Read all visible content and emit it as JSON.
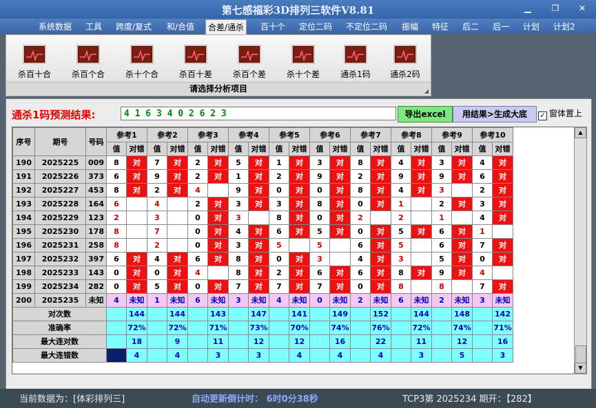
{
  "window": {
    "title": "第七感福彩3D排列三软件V8.81"
  },
  "menu": [
    "系统数据",
    "工具",
    "跨度/复式",
    "和/合值",
    "合差/通杀",
    "百十个",
    "定位二码",
    "不定位二码",
    "振幅",
    "特征",
    "后二",
    "后一",
    "计划",
    "计划2"
  ],
  "menu_active_index": 4,
  "ribbon": {
    "buttons": [
      "杀百十合",
      "杀百个合",
      "杀十个合",
      "杀百十差",
      "杀百个差",
      "杀十个差",
      "通杀1码",
      "通杀2码"
    ],
    "footer": "请选择分析项目"
  },
  "prediction": {
    "label": "通杀1码预测结果:",
    "digits": "4 1 6 3 4 0 2 6 2 3",
    "export_button": "导出excel",
    "big_button": "用结果>生成大底",
    "on_top_label": "窗体置上",
    "on_top_checked": true
  },
  "table": {
    "headers": {
      "seq": "序号",
      "issue": "期号",
      "number": "号码",
      "value": "值",
      "judge": "对错"
    },
    "refs": [
      "参考1",
      "参考2",
      "参考3",
      "参考4",
      "参考5",
      "参考6",
      "参考7",
      "参考8",
      "参考9",
      "参考10"
    ],
    "mark_right": "对",
    "rows": [
      {
        "seq": "190",
        "issue": "2025225",
        "num": "009",
        "cells": [
          [
            "8",
            "对",
            0
          ],
          [
            "7",
            "对",
            0
          ],
          [
            "2",
            "对",
            0
          ],
          [
            "5",
            "对",
            0
          ],
          [
            "1",
            "对",
            0
          ],
          [
            "3",
            "对",
            0
          ],
          [
            "8",
            "对",
            0
          ],
          [
            "4",
            "对",
            0
          ],
          [
            "3",
            "对",
            0
          ],
          [
            "4",
            "对",
            0
          ]
        ]
      },
      {
        "seq": "191",
        "issue": "2025226",
        "num": "373",
        "cells": [
          [
            "6",
            "对",
            0
          ],
          [
            "9",
            "对",
            0
          ],
          [
            "2",
            "对",
            0
          ],
          [
            "1",
            "对",
            0
          ],
          [
            "2",
            "对",
            0
          ],
          [
            "9",
            "对",
            0
          ],
          [
            "2",
            "对",
            0
          ],
          [
            "9",
            "对",
            0
          ],
          [
            "9",
            "对",
            0
          ],
          [
            "6",
            "对",
            0
          ]
        ]
      },
      {
        "seq": "192",
        "issue": "2025227",
        "num": "453",
        "cells": [
          [
            "8",
            "对",
            0
          ],
          [
            "2",
            "对",
            0
          ],
          [
            "4",
            "",
            1
          ],
          [
            "9",
            "对",
            0
          ],
          [
            "0",
            "对",
            0
          ],
          [
            "0",
            "对",
            0
          ],
          [
            "8",
            "对",
            0
          ],
          [
            "4",
            "对",
            0
          ],
          [
            "3",
            "",
            1
          ],
          [
            "2",
            "对",
            0
          ]
        ]
      },
      {
        "seq": "193",
        "issue": "2025228",
        "num": "164",
        "cells": [
          [
            "6",
            "",
            1
          ],
          [
            "4",
            "",
            1
          ],
          [
            "2",
            "对",
            0
          ],
          [
            "3",
            "对",
            0
          ],
          [
            "3",
            "对",
            0
          ],
          [
            "8",
            "对",
            0
          ],
          [
            "0",
            "对",
            0
          ],
          [
            "1",
            "",
            1
          ],
          [
            "2",
            "对",
            0
          ],
          [
            "3",
            "对",
            0
          ]
        ]
      },
      {
        "seq": "194",
        "issue": "2025229",
        "num": "123",
        "cells": [
          [
            "2",
            "",
            1
          ],
          [
            "3",
            "",
            1
          ],
          [
            "0",
            "对",
            0
          ],
          [
            "3",
            "",
            1
          ],
          [
            "8",
            "对",
            0
          ],
          [
            "0",
            "对",
            0
          ],
          [
            "2",
            "",
            1
          ],
          [
            "2",
            "",
            1
          ],
          [
            "1",
            "",
            1
          ],
          [
            "4",
            "对",
            0
          ]
        ]
      },
      {
        "seq": "195",
        "issue": "2025230",
        "num": "178",
        "cells": [
          [
            "8",
            "",
            1
          ],
          [
            "7",
            "",
            1
          ],
          [
            "0",
            "对",
            0
          ],
          [
            "4",
            "对",
            0
          ],
          [
            "6",
            "对",
            0
          ],
          [
            "5",
            "对",
            0
          ],
          [
            "0",
            "对",
            0
          ],
          [
            "5",
            "对",
            0
          ],
          [
            "6",
            "对",
            0
          ],
          [
            "1",
            "",
            1
          ]
        ]
      },
      {
        "seq": "196",
        "issue": "2025231",
        "num": "258",
        "cells": [
          [
            "8",
            "",
            1
          ],
          [
            "2",
            "",
            1
          ],
          [
            "0",
            "对",
            0
          ],
          [
            "3",
            "对",
            0
          ],
          [
            "5",
            "",
            1
          ],
          [
            "5",
            "",
            1
          ],
          [
            "6",
            "对",
            0
          ],
          [
            "5",
            "",
            1
          ],
          [
            "6",
            "对",
            0
          ],
          [
            "7",
            "对",
            0
          ]
        ]
      },
      {
        "seq": "197",
        "issue": "2025232",
        "num": "397",
        "cells": [
          [
            "6",
            "对",
            0
          ],
          [
            "4",
            "对",
            0
          ],
          [
            "6",
            "对",
            0
          ],
          [
            "8",
            "对",
            0
          ],
          [
            "0",
            "对",
            0
          ],
          [
            "3",
            "",
            1
          ],
          [
            "4",
            "对",
            0
          ],
          [
            "3",
            "",
            1
          ],
          [
            "5",
            "对",
            0
          ],
          [
            "0",
            "对",
            0
          ]
        ]
      },
      {
        "seq": "198",
        "issue": "2025233",
        "num": "143",
        "cells": [
          [
            "0",
            "对",
            0
          ],
          [
            "0",
            "对",
            0
          ],
          [
            "4",
            "",
            1
          ],
          [
            "8",
            "对",
            0
          ],
          [
            "2",
            "对",
            0
          ],
          [
            "6",
            "对",
            0
          ],
          [
            "6",
            "对",
            0
          ],
          [
            "8",
            "对",
            0
          ],
          [
            "9",
            "对",
            0
          ],
          [
            "4",
            "",
            1
          ]
        ]
      },
      {
        "seq": "199",
        "issue": "2025234",
        "num": "282",
        "cells": [
          [
            "0",
            "对",
            0
          ],
          [
            "5",
            "对",
            0
          ],
          [
            "0",
            "对",
            0
          ],
          [
            "7",
            "对",
            0
          ],
          [
            "7",
            "对",
            0
          ],
          [
            "7",
            "对",
            0
          ],
          [
            "0",
            "对",
            0
          ],
          [
            "8",
            "",
            1
          ],
          [
            "8",
            "",
            1
          ],
          [
            "7",
            "对",
            0
          ]
        ]
      }
    ],
    "unknown_row": {
      "seq": "200",
      "issue": "2025235",
      "num": "未知",
      "values": [
        "4",
        "1",
        "6",
        "3",
        "4",
        "0",
        "2",
        "6",
        "2",
        "3"
      ],
      "judge": "未知"
    },
    "stats": [
      {
        "label": "对次数",
        "values": [
          "144",
          "144",
          "143",
          "147",
          "141",
          "149",
          "152",
          "144",
          "148",
          "142"
        ]
      },
      {
        "label": "准确率",
        "values": [
          "72%",
          "72%",
          "71%",
          "73%",
          "70%",
          "74%",
          "76%",
          "72%",
          "74%",
          "71%"
        ]
      },
      {
        "label": "最大连对数",
        "values": [
          "18",
          "9",
          "11",
          "12",
          "12",
          "16",
          "22",
          "11",
          "12",
          "16"
        ]
      },
      {
        "label": "最大连错数",
        "values": [
          "4",
          "4",
          "3",
          "3",
          "4",
          "4",
          "4",
          "3",
          "5",
          "3"
        ]
      }
    ]
  },
  "status": {
    "current": "当前数据为：[体彩排列三]",
    "countdown": "自动更新倒计时：  6时0分38秒",
    "issue": "TCP3第 2025234 期开：【282】"
  },
  "colors": {
    "right_mark": "#ee1111",
    "unknown_row": "#f3c8f3",
    "stats": "#80ffff",
    "title": "#3563a8"
  }
}
